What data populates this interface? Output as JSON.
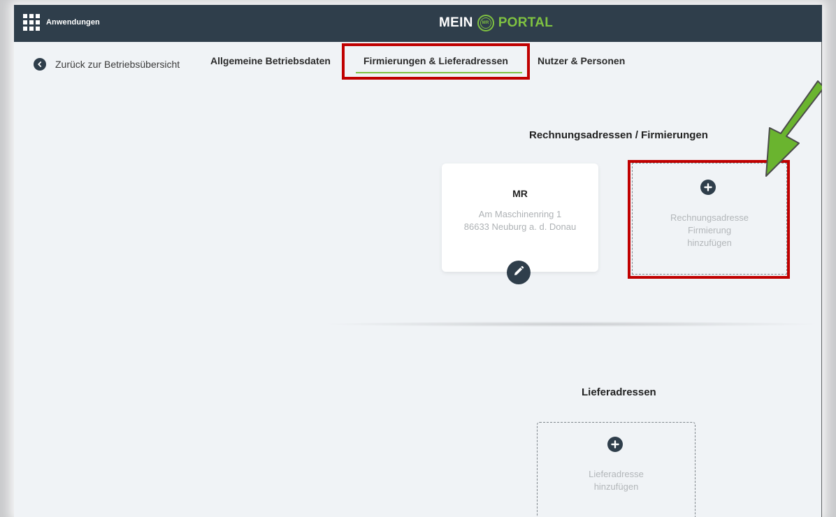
{
  "header": {
    "apps_label": "Anwendungen",
    "logo_mein": "MEIN",
    "logo_badge": "MR",
    "logo_portal": "PORTAL"
  },
  "nav": {
    "back_label": "Zurück zur Betriebsübersicht",
    "tabs": [
      {
        "label": "Allgemeine Betriebsdaten"
      },
      {
        "label": "Firmierungen & Lieferadressen"
      },
      {
        "label": "Nutzer & Personen"
      }
    ],
    "active_tab": "Firmierungen & Lieferadressen"
  },
  "billing": {
    "title": "Rechnungsadressen / Firmierungen",
    "card": {
      "name": "MR",
      "line1": "Am Maschinenring 1",
      "line2": "86633 Neuburg a. d. Donau"
    },
    "add_line1": "Rechnungsadresse",
    "add_line2": "Firmierung",
    "add_line3": "hinzufügen"
  },
  "delivery": {
    "title": "Lieferadressen",
    "add_line1": "Lieferadresse",
    "add_line2": "hinzufügen"
  },
  "colors": {
    "header_bg": "#2f3e4b",
    "accent_green": "#7fc241",
    "highlight_red": "#c00000",
    "arrow_green": "#6ab42f"
  },
  "icons": [
    "apps-grid-icon",
    "back-chevron-icon",
    "pencil-icon",
    "plus-icon",
    "annotation-arrow"
  ]
}
